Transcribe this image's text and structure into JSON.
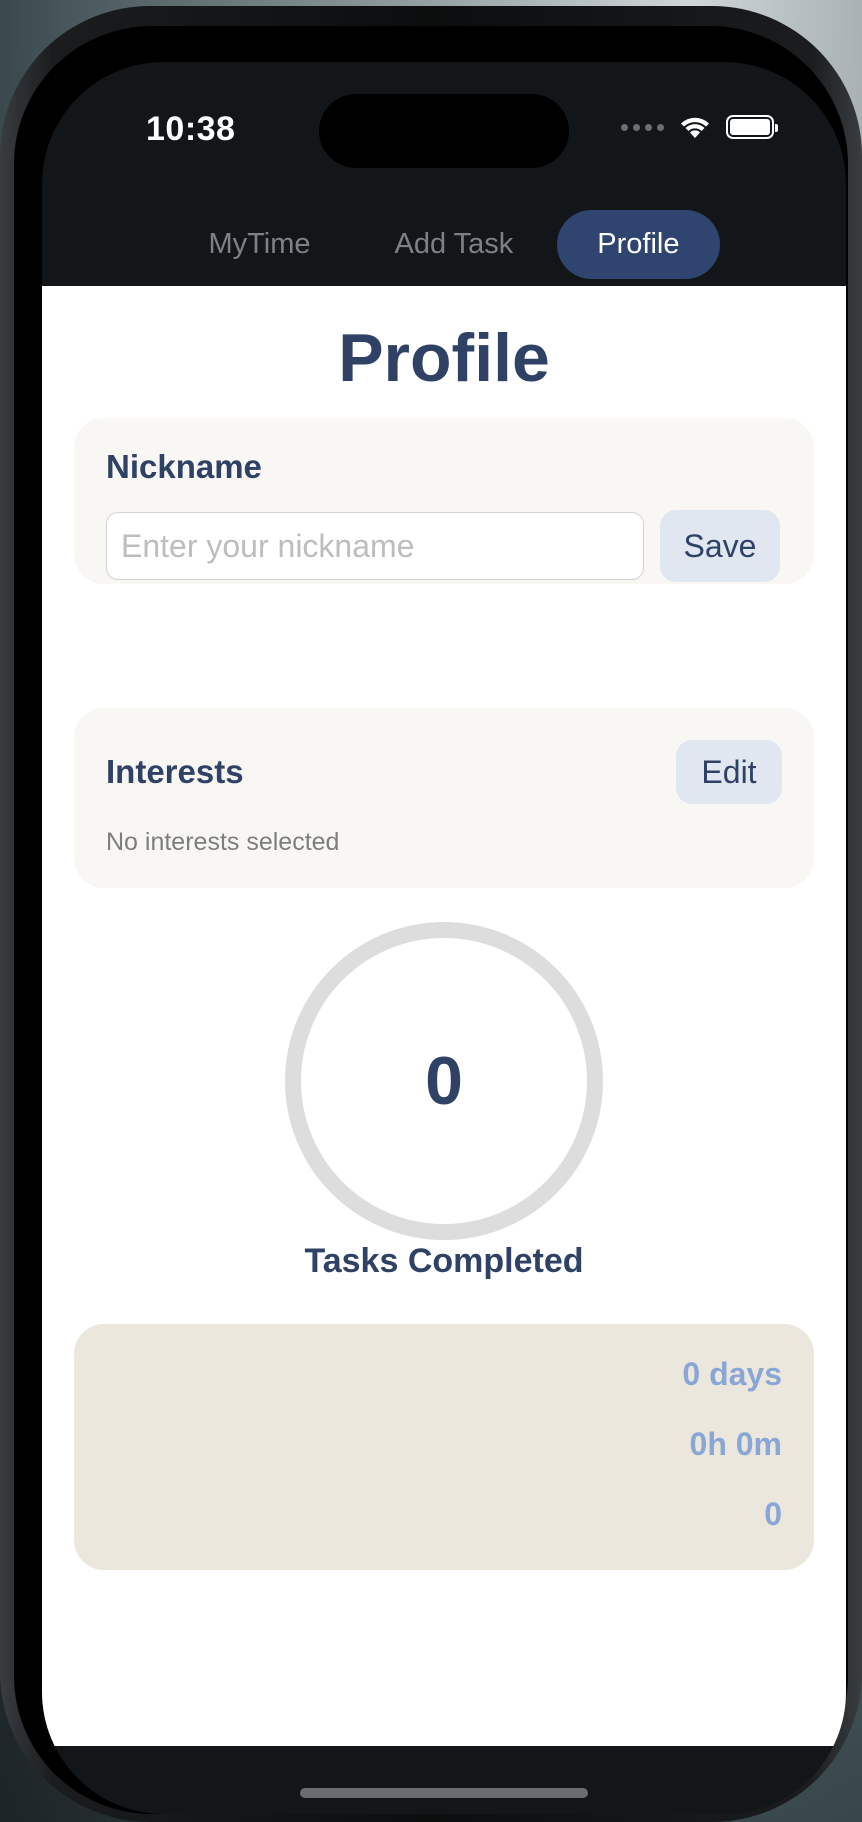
{
  "status_bar": {
    "time": "10:38",
    "icons": [
      "signal-dots-icon",
      "wifi-icon",
      "battery-icon"
    ]
  },
  "tabs": [
    {
      "label": "MyTime",
      "active": false
    },
    {
      "label": "Add Task",
      "active": false
    },
    {
      "label": "Profile",
      "active": true
    }
  ],
  "page": {
    "title": "Profile"
  },
  "nickname": {
    "label": "Nickname",
    "value": "",
    "placeholder": "Enter your nickname",
    "save_label": "Save"
  },
  "interests": {
    "label": "Interests",
    "edit_label": "Edit",
    "empty_text": "No interests selected"
  },
  "progress": {
    "count": "0",
    "label": "Tasks Completed",
    "fraction": 0
  },
  "stats": {
    "streak": "0 days",
    "time": "0h 0m",
    "points": "0"
  },
  "colors": {
    "accent": "#2f4570",
    "title": "#2f4266",
    "stat_text": "#8aa6d6",
    "card_bg": "#f8f7f4",
    "stats_bg": "#ebe7dd",
    "ring_track": "#dddddd"
  }
}
